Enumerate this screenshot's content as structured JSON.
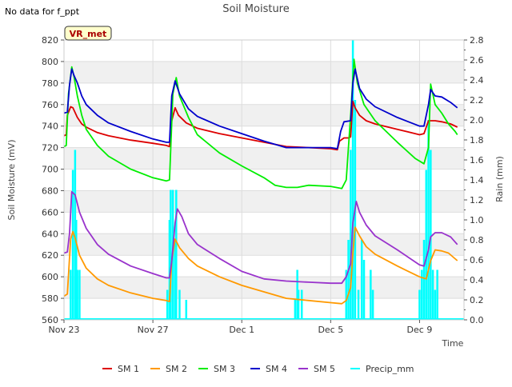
{
  "note": "No data for f_ppt",
  "chart_data": {
    "type": "line",
    "title": "Soil Moisture",
    "site_badge": "VR_met",
    "xlabel": "Time",
    "ylabel": "Soil Moisture (mV)",
    "y2label": "Rain (mm)",
    "x_tick_labels": [
      "Nov 23",
      "Nov 27",
      "Dec 1",
      "Dec 5",
      "Dec 9"
    ],
    "x_tick_days": [
      0,
      4,
      8,
      12,
      16
    ],
    "xlim_days": [
      0,
      18
    ],
    "ylim": [
      560,
      820
    ],
    "y_ticks": [
      560,
      580,
      600,
      620,
      640,
      660,
      680,
      700,
      720,
      740,
      760,
      780,
      800,
      820
    ],
    "y2lim": [
      0,
      2.8
    ],
    "y2_ticks": [
      0.0,
      0.2,
      0.4,
      0.6,
      0.8,
      1.0,
      1.2,
      1.4,
      1.6,
      1.8,
      2.0,
      2.2,
      2.4,
      2.6,
      2.8
    ],
    "legend_position": "bottom",
    "series": [
      {
        "name": "SM 1",
        "color": "#dd0000",
        "axis": "left",
        "points": [
          [
            0,
            731
          ],
          [
            0.1,
            732
          ],
          [
            0.15,
            750
          ],
          [
            0.3,
            758
          ],
          [
            0.4,
            757
          ],
          [
            0.6,
            748
          ],
          [
            0.8,
            742
          ],
          [
            1,
            739
          ],
          [
            1.5,
            734
          ],
          [
            2,
            731
          ],
          [
            3,
            727
          ],
          [
            4,
            724
          ],
          [
            4.6,
            722
          ],
          [
            4.75,
            721
          ],
          [
            4.85,
            745
          ],
          [
            5.0,
            757
          ],
          [
            5.15,
            750
          ],
          [
            5.5,
            743
          ],
          [
            6,
            738
          ],
          [
            7,
            733
          ],
          [
            8,
            729
          ],
          [
            9,
            725
          ],
          [
            10,
            721
          ],
          [
            11,
            720
          ],
          [
            12,
            719
          ],
          [
            12.3,
            718
          ],
          [
            12.4,
            726
          ],
          [
            12.6,
            729
          ],
          [
            12.8,
            729
          ],
          [
            12.9,
            730
          ],
          [
            13.0,
            763
          ],
          [
            13.1,
            757
          ],
          [
            13.3,
            750
          ],
          [
            13.6,
            745
          ],
          [
            14,
            742
          ],
          [
            15,
            737
          ],
          [
            15.8,
            733
          ],
          [
            16.0,
            732
          ],
          [
            16.2,
            733
          ],
          [
            16.4,
            745
          ],
          [
            16.7,
            745
          ],
          [
            17,
            744
          ],
          [
            17.4,
            742
          ],
          [
            17.7,
            739
          ]
        ]
      },
      {
        "name": "SM 2",
        "color": "#ff9900",
        "axis": "left",
        "points": [
          [
            0,
            582
          ],
          [
            0.15,
            584
          ],
          [
            0.3,
            635
          ],
          [
            0.4,
            642
          ],
          [
            0.5,
            636
          ],
          [
            0.7,
            620
          ],
          [
            1,
            608
          ],
          [
            1.5,
            598
          ],
          [
            2,
            592
          ],
          [
            3,
            585
          ],
          [
            4,
            580
          ],
          [
            4.6,
            578
          ],
          [
            4.75,
            577
          ],
          [
            4.85,
            615
          ],
          [
            5.0,
            635
          ],
          [
            5.2,
            627
          ],
          [
            5.6,
            617
          ],
          [
            6,
            610
          ],
          [
            7,
            600
          ],
          [
            8,
            592
          ],
          [
            9,
            586
          ],
          [
            10,
            580
          ],
          [
            11,
            578
          ],
          [
            12,
            576
          ],
          [
            12.5,
            575
          ],
          [
            12.7,
            578
          ],
          [
            12.9,
            590
          ],
          [
            13.0,
            622
          ],
          [
            13.1,
            646
          ],
          [
            13.3,
            638
          ],
          [
            13.6,
            628
          ],
          [
            14,
            621
          ],
          [
            15,
            610
          ],
          [
            16,
            600
          ],
          [
            16.3,
            598
          ],
          [
            16.5,
            615
          ],
          [
            16.7,
            625
          ],
          [
            17,
            624
          ],
          [
            17.3,
            622
          ],
          [
            17.7,
            615
          ]
        ]
      },
      {
        "name": "SM 3",
        "color": "#00ee00",
        "axis": "left",
        "points": [
          [
            0,
            721
          ],
          [
            0.1,
            722
          ],
          [
            0.2,
            770
          ],
          [
            0.35,
            795
          ],
          [
            0.45,
            786
          ],
          [
            0.6,
            768
          ],
          [
            0.8,
            750
          ],
          [
            1,
            737
          ],
          [
            1.5,
            722
          ],
          [
            2,
            712
          ],
          [
            3,
            700
          ],
          [
            4,
            692
          ],
          [
            4.6,
            689
          ],
          [
            4.75,
            690
          ],
          [
            4.9,
            770
          ],
          [
            5.05,
            785
          ],
          [
            5.2,
            768
          ],
          [
            5.6,
            748
          ],
          [
            6,
            732
          ],
          [
            7,
            715
          ],
          [
            8,
            703
          ],
          [
            9,
            692
          ],
          [
            9.5,
            685
          ],
          [
            10,
            683
          ],
          [
            10.5,
            683
          ],
          [
            11,
            685
          ],
          [
            12,
            684
          ],
          [
            12.5,
            682
          ],
          [
            12.7,
            690
          ],
          [
            12.9,
            750
          ],
          [
            13.05,
            802
          ],
          [
            13.2,
            780
          ],
          [
            13.5,
            760
          ],
          [
            14,
            745
          ],
          [
            15,
            725
          ],
          [
            15.8,
            710
          ],
          [
            16.2,
            705
          ],
          [
            16.4,
            720
          ],
          [
            16.5,
            779
          ],
          [
            16.7,
            760
          ],
          [
            17,
            752
          ],
          [
            17.3,
            742
          ],
          [
            17.6,
            735
          ],
          [
            17.7,
            732
          ]
        ]
      },
      {
        "name": "SM 4",
        "color": "#0000cc",
        "axis": "left",
        "points": [
          [
            0,
            752
          ],
          [
            0.15,
            753
          ],
          [
            0.25,
            778
          ],
          [
            0.35,
            793
          ],
          [
            0.45,
            787
          ],
          [
            0.6,
            780
          ],
          [
            0.8,
            768
          ],
          [
            1,
            760
          ],
          [
            1.5,
            750
          ],
          [
            2,
            743
          ],
          [
            3,
            735
          ],
          [
            4,
            728
          ],
          [
            4.6,
            725
          ],
          [
            4.75,
            725
          ],
          [
            4.85,
            768
          ],
          [
            5.0,
            782
          ],
          [
            5.2,
            770
          ],
          [
            5.6,
            756
          ],
          [
            6,
            749
          ],
          [
            7,
            740
          ],
          [
            8,
            733
          ],
          [
            9,
            726
          ],
          [
            10,
            720
          ],
          [
            11,
            720
          ],
          [
            12,
            720
          ],
          [
            12.3,
            719
          ],
          [
            12.45,
            735
          ],
          [
            12.6,
            744
          ],
          [
            12.9,
            745
          ],
          [
            13.0,
            780
          ],
          [
            13.1,
            793
          ],
          [
            13.3,
            775
          ],
          [
            13.6,
            765
          ],
          [
            14,
            758
          ],
          [
            15,
            748
          ],
          [
            16,
            740
          ],
          [
            16.2,
            740
          ],
          [
            16.4,
            760
          ],
          [
            16.5,
            774
          ],
          [
            16.7,
            768
          ],
          [
            17,
            767
          ],
          [
            17.4,
            762
          ],
          [
            17.7,
            757
          ]
        ]
      },
      {
        "name": "SM 5",
        "color": "#9933cc",
        "axis": "left",
        "points": [
          [
            0,
            622
          ],
          [
            0.15,
            623
          ],
          [
            0.25,
            640
          ],
          [
            0.35,
            679
          ],
          [
            0.5,
            676
          ],
          [
            0.7,
            660
          ],
          [
            1,
            645
          ],
          [
            1.5,
            630
          ],
          [
            2,
            621
          ],
          [
            3,
            610
          ],
          [
            4,
            603
          ],
          [
            4.6,
            599
          ],
          [
            4.75,
            599
          ],
          [
            4.85,
            615
          ],
          [
            5.0,
            650
          ],
          [
            5.1,
            663
          ],
          [
            5.3,
            656
          ],
          [
            5.6,
            640
          ],
          [
            6,
            630
          ],
          [
            7,
            617
          ],
          [
            8,
            605
          ],
          [
            9,
            598
          ],
          [
            10,
            596
          ],
          [
            11,
            595
          ],
          [
            12,
            594
          ],
          [
            12.5,
            594
          ],
          [
            12.7,
            600
          ],
          [
            12.9,
            612
          ],
          [
            13.0,
            650
          ],
          [
            13.15,
            670
          ],
          [
            13.3,
            660
          ],
          [
            13.6,
            648
          ],
          [
            14,
            638
          ],
          [
            15,
            625
          ],
          [
            16,
            611
          ],
          [
            16.2,
            610
          ],
          [
            16.4,
            625
          ],
          [
            16.5,
            637
          ],
          [
            16.7,
            641
          ],
          [
            17,
            641
          ],
          [
            17.4,
            637
          ],
          [
            17.7,
            630
          ]
        ]
      },
      {
        "name": "Precip_mm",
        "color": "#00ffff",
        "axis": "right",
        "bars": [
          [
            0.3,
            0.5
          ],
          [
            0.4,
            1.5
          ],
          [
            0.5,
            1.7
          ],
          [
            0.55,
            1.0
          ],
          [
            0.6,
            0.5
          ],
          [
            0.7,
            0.5
          ],
          [
            4.65,
            0.3
          ],
          [
            4.75,
            1.0
          ],
          [
            4.8,
            1.3
          ],
          [
            4.9,
            1.3
          ],
          [
            5.0,
            0.8
          ],
          [
            5.05,
            1.3
          ],
          [
            5.2,
            0.3
          ],
          [
            5.5,
            0.2
          ],
          [
            10.4,
            0.2
          ],
          [
            10.5,
            0.5
          ],
          [
            10.55,
            0.3
          ],
          [
            10.7,
            0.3
          ],
          [
            12.7,
            0.5
          ],
          [
            12.8,
            0.8
          ],
          [
            12.9,
            1.7
          ],
          [
            13.0,
            2.8
          ],
          [
            13.1,
            2.2
          ],
          [
            13.25,
            0.3
          ],
          [
            13.4,
            0.8
          ],
          [
            13.5,
            0.6
          ],
          [
            13.8,
            0.5
          ],
          [
            13.9,
            0.3
          ],
          [
            16.0,
            0.3
          ],
          [
            16.1,
            0.5
          ],
          [
            16.2,
            0.8
          ],
          [
            16.3,
            1.5
          ],
          [
            16.4,
            2.0
          ],
          [
            16.5,
            1.7
          ],
          [
            16.6,
            0.5
          ],
          [
            16.7,
            0.3
          ],
          [
            16.8,
            0.5
          ]
        ]
      }
    ]
  }
}
